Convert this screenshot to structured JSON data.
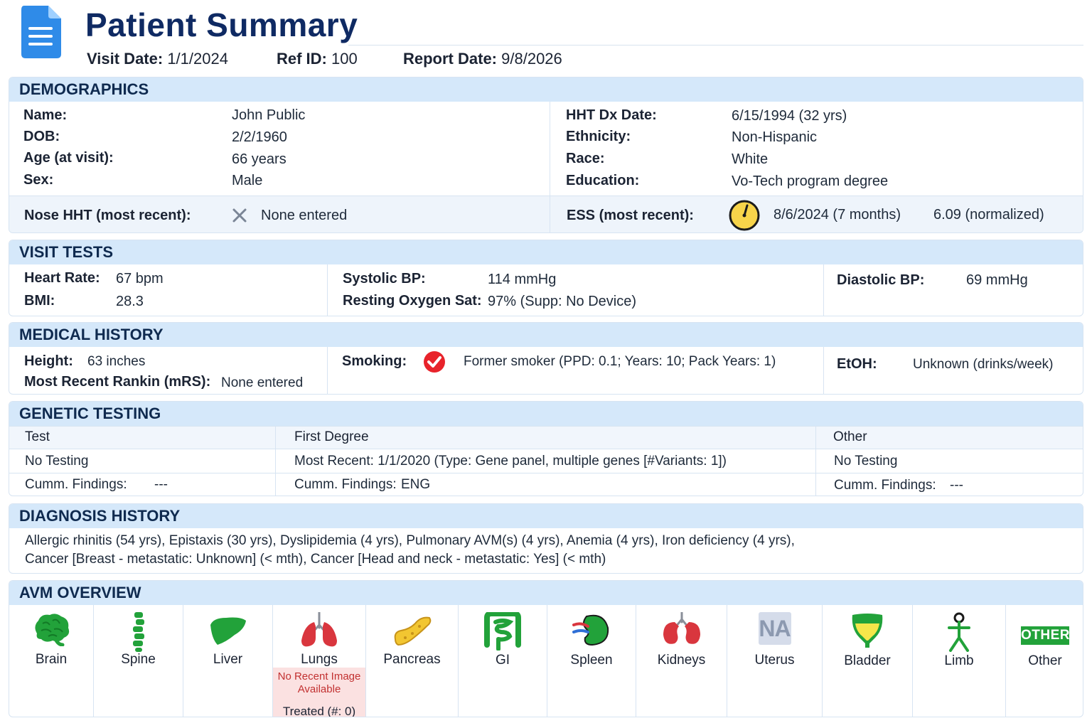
{
  "header": {
    "title": "Patient Summary",
    "visit_date_label": "Visit Date:",
    "visit_date": "1/1/2024",
    "ref_id_label": "Ref ID:",
    "ref_id": "100",
    "report_date_label": "Report Date:",
    "report_date": "9/8/2026",
    "icon": "document-icon"
  },
  "demographics": {
    "title": "DEMOGRAPHICS",
    "left": [
      {
        "label": "Name:",
        "value": "John Public"
      },
      {
        "label": "DOB:",
        "value": "2/2/1960"
      },
      {
        "label": "Age (at visit):",
        "value": "66 years"
      },
      {
        "label": "Sex:",
        "value": "Male"
      }
    ],
    "right": [
      {
        "label": "HHT Dx Date:",
        "value": "6/15/1994 (32 yrs)"
      },
      {
        "label": "Ethnicity:",
        "value": "Non-Hispanic"
      },
      {
        "label": "Race:",
        "value": "White"
      },
      {
        "label": "Education:",
        "value": "Vo-Tech program degree"
      }
    ],
    "nose_label": "Nose HHT (most recent):",
    "nose_value": "None entered",
    "nose_icon": "x-icon",
    "ess_label": "ESS (most recent):",
    "ess_date": "8/6/2024 (7 months)",
    "ess_score": "6.09 (normalized)",
    "ess_icon": "clock-icon"
  },
  "visit_tests": {
    "title": "VISIT TESTS",
    "heart_rate_label": "Heart Rate:",
    "heart_rate": "67 bpm",
    "bmi_label": "BMI:",
    "bmi": "28.3",
    "systolic_label": "Systolic BP:",
    "systolic": "114 mmHg",
    "oxygen_label": "Resting Oxygen Sat:",
    "oxygen": "97% (Supp: No Device)",
    "diastolic_label": "Diastolic BP:",
    "diastolic": "69 mmHg"
  },
  "medical_history": {
    "title": "MEDICAL HISTORY",
    "height_label": "Height:",
    "height": "63 inches",
    "rankin_label": "Most Recent Rankin (mRS):",
    "rankin": "None entered",
    "smoking_label": "Smoking:",
    "smoking": "Former smoker (PPD: 0.1; Years: 10; Pack Years: 1)",
    "smoking_icon": "check-circle-icon",
    "etoh_label": "EtOH:",
    "etoh": "Unknown (drinks/week)"
  },
  "genetic_testing": {
    "title": "GENETIC TESTING",
    "columns": [
      "Test",
      "First Degree",
      "Other"
    ],
    "row1": [
      "No Testing",
      "Most Recent:  1/1/2020 (Type:  Gene panel, multiple genes [#Variants: 1])",
      "No Testing"
    ],
    "findings_label": "Cumm. Findings:",
    "findings": [
      "---",
      "ENG",
      "---"
    ]
  },
  "diagnosis_history": {
    "title": "DIAGNOSIS HISTORY",
    "line1": "Allergic rhinitis (54 yrs), Epistaxis (30 yrs), Dyslipidemia (4 yrs), Pulmonary AVM(s) (4 yrs), Anemia (4 yrs), Iron deficiency (4 yrs),",
    "line2": "Cancer [Breast - metastatic: Unknown] (< mth), Cancer [Head and neck - metastatic: Yes] (< mth)"
  },
  "avm_overview": {
    "title": "AVM OVERVIEW",
    "organs": [
      {
        "label": "Brain",
        "icon": "brain-icon"
      },
      {
        "label": "Spine",
        "icon": "spine-icon"
      },
      {
        "label": "Liver",
        "icon": "liver-icon"
      },
      {
        "label": "Lungs",
        "icon": "lungs-icon",
        "alert": "No Recent Image Available",
        "treated": "Treated (#: 0)"
      },
      {
        "label": "Pancreas",
        "icon": "pancreas-icon"
      },
      {
        "label": "GI",
        "icon": "intestine-icon"
      },
      {
        "label": "Spleen",
        "icon": "spleen-icon"
      },
      {
        "label": "Kidneys",
        "icon": "kidneys-icon"
      },
      {
        "label": "Uterus",
        "icon": "na-icon",
        "icon_text": "NA"
      },
      {
        "label": "Bladder",
        "icon": "bladder-icon"
      },
      {
        "label": "Limb",
        "icon": "stick-figure-icon"
      },
      {
        "label": "Other",
        "icon": "other-badge-icon",
        "icon_text": "OTHER"
      }
    ]
  },
  "colors": {
    "title": "#0f2a63",
    "section_header_bg": "#d5e8fa",
    "organ_green": "#22a23a",
    "alert_bg": "#fbe1e1",
    "alert_text": "#c23131",
    "check_red": "#e8232b",
    "clock_yellow": "#f7d44a"
  }
}
